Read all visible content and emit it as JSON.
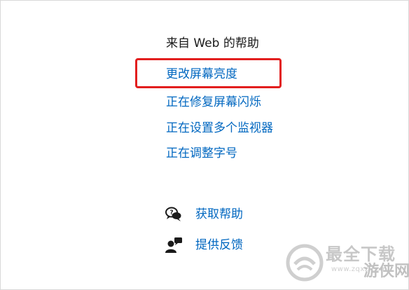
{
  "help_section": {
    "title": "来自 Web 的帮助",
    "links": [
      "更改屏幕亮度",
      "正在修复屏幕闪烁",
      "正在设置多个监视器",
      "正在调整字号"
    ],
    "highlighted_index": 0,
    "highlight_color": "#e21e1e",
    "link_color": "#0067c0"
  },
  "footer": {
    "items": [
      {
        "label": "获取帮助",
        "icon": "chat-bubbles-icon"
      },
      {
        "label": "提供反馈",
        "icon": "person-feedback-icon"
      }
    ]
  },
  "watermark": {
    "brand": "最全下载",
    "domain": "www.zqxz.com",
    "partner": "游侠网"
  }
}
